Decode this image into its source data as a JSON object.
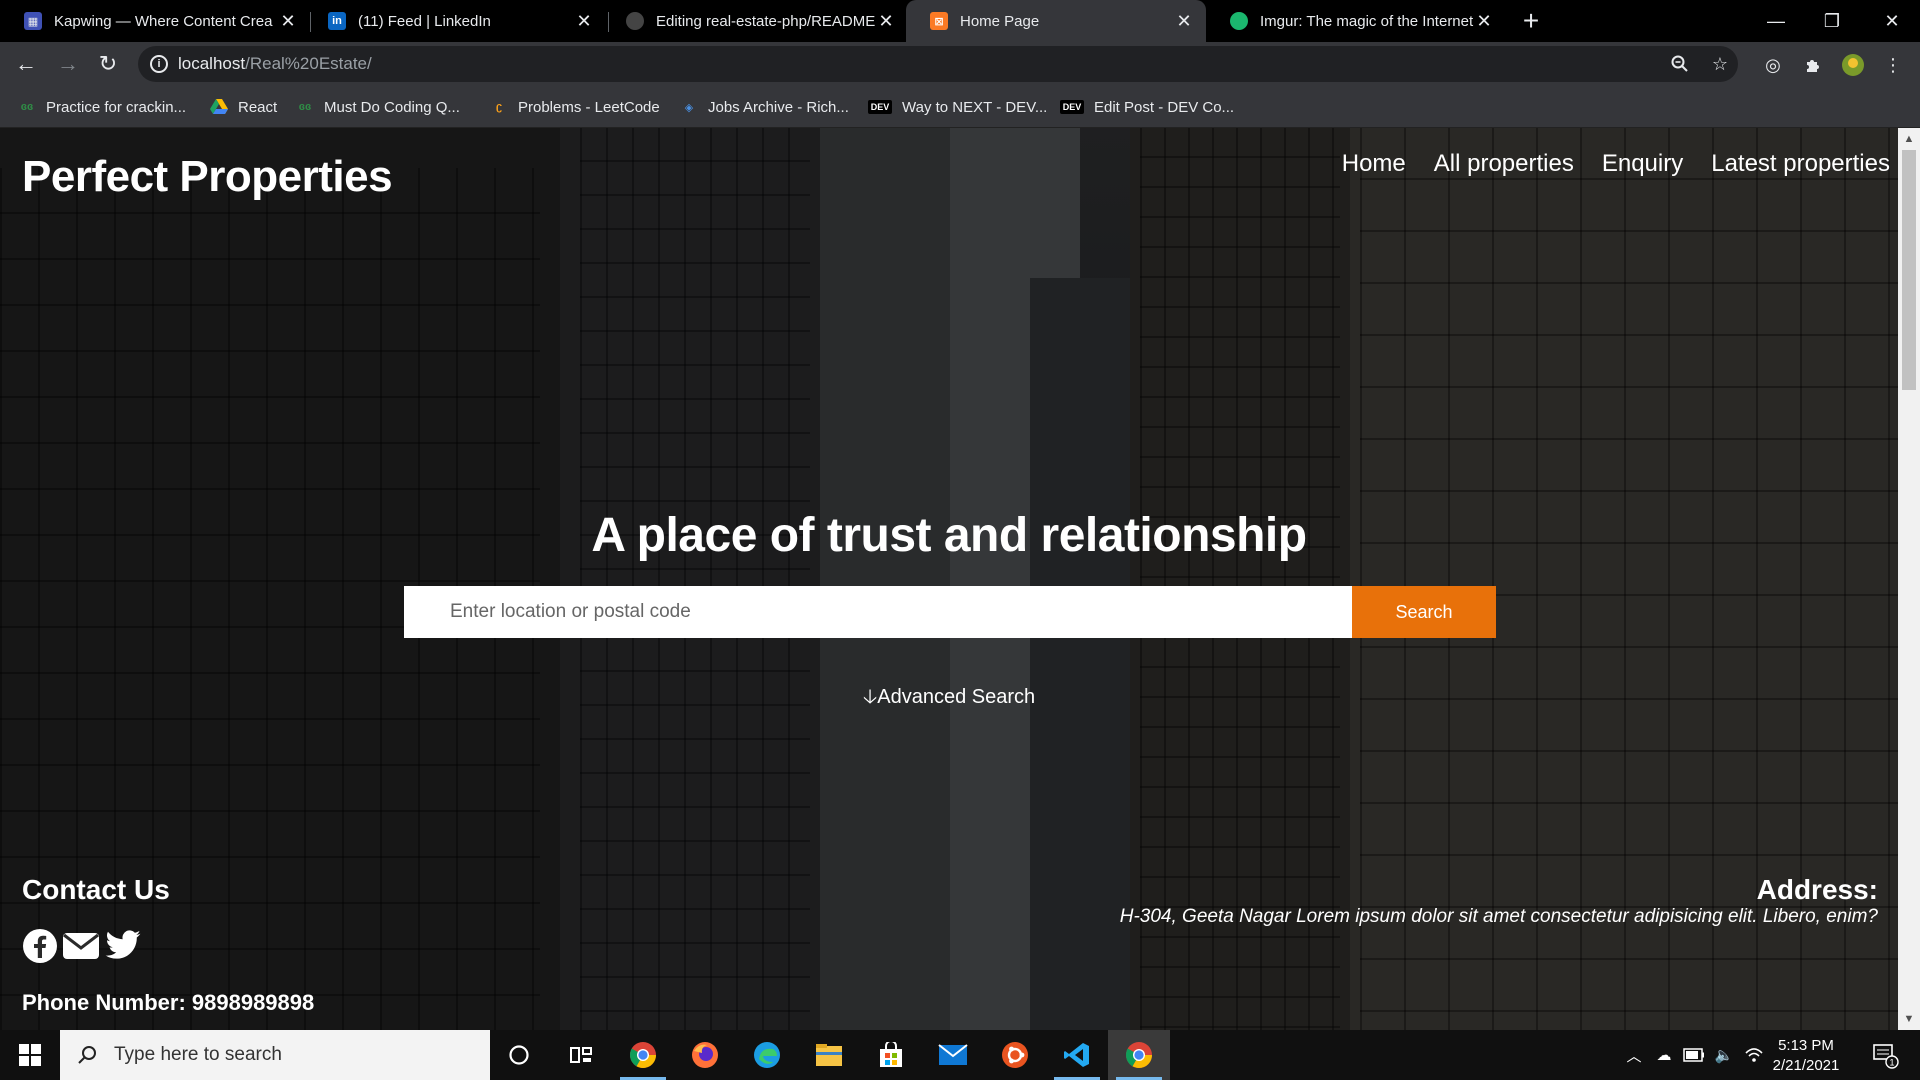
{
  "browser": {
    "tabs": [
      {
        "title": "Kapwing — Where Content Crea",
        "icon": "kapwing-icon",
        "color": "#3f51b5"
      },
      {
        "title": "(11) Feed | LinkedIn",
        "icon": "linkedin-icon",
        "color": "#0a66c2"
      },
      {
        "title": "Editing real-estate-php/README",
        "icon": "github-icon",
        "color": "#24292e"
      },
      {
        "title": "Home Page",
        "icon": "xampp-icon",
        "color": "#fb7a24"
      },
      {
        "title": "Imgur: The magic of the Internet",
        "icon": "imgur-icon",
        "color": "#1bb76e"
      }
    ],
    "active_tab": 3,
    "address": {
      "host": "localhost",
      "path": "/Real%20Estate/"
    },
    "bookmarks": [
      {
        "label": "Practice for crackin...",
        "icon": "gfg-icon"
      },
      {
        "label": "React",
        "icon": "drive-icon"
      },
      {
        "label": "Must Do Coding Q...",
        "icon": "gfg-icon"
      },
      {
        "label": "Problems - LeetCode",
        "icon": "leetcode-icon"
      },
      {
        "label": "Jobs Archive - Rich...",
        "icon": "jobs-icon"
      },
      {
        "label": "Way to NEXT - DEV...",
        "icon": "dev-icon"
      },
      {
        "label": "Edit Post - DEV Co...",
        "icon": "dev-icon"
      }
    ],
    "dev_badge": "DEV"
  },
  "site": {
    "brand": "Perfect Properties",
    "nav": [
      "Home",
      "All properties",
      "Enquiry",
      "Latest properties"
    ],
    "hero_title": "A place of trust and relationship",
    "search_placeholder": "Enter location or postal code",
    "search_button": "Search",
    "advanced_search": "Advanced Search",
    "contact_heading": "Contact Us",
    "phone": "Phone Number: 9898989898",
    "address_heading": "Address:",
    "address_text": "H-304, Geeta Nagar Lorem ipsum dolor sit amet consectetur adipisicing elit. Libero, enim?",
    "accent": "#e8710a"
  },
  "taskbar": {
    "search_placeholder": "Type here to search",
    "time": "5:13 PM",
    "date": "2/21/2021",
    "notification_count": "1"
  }
}
